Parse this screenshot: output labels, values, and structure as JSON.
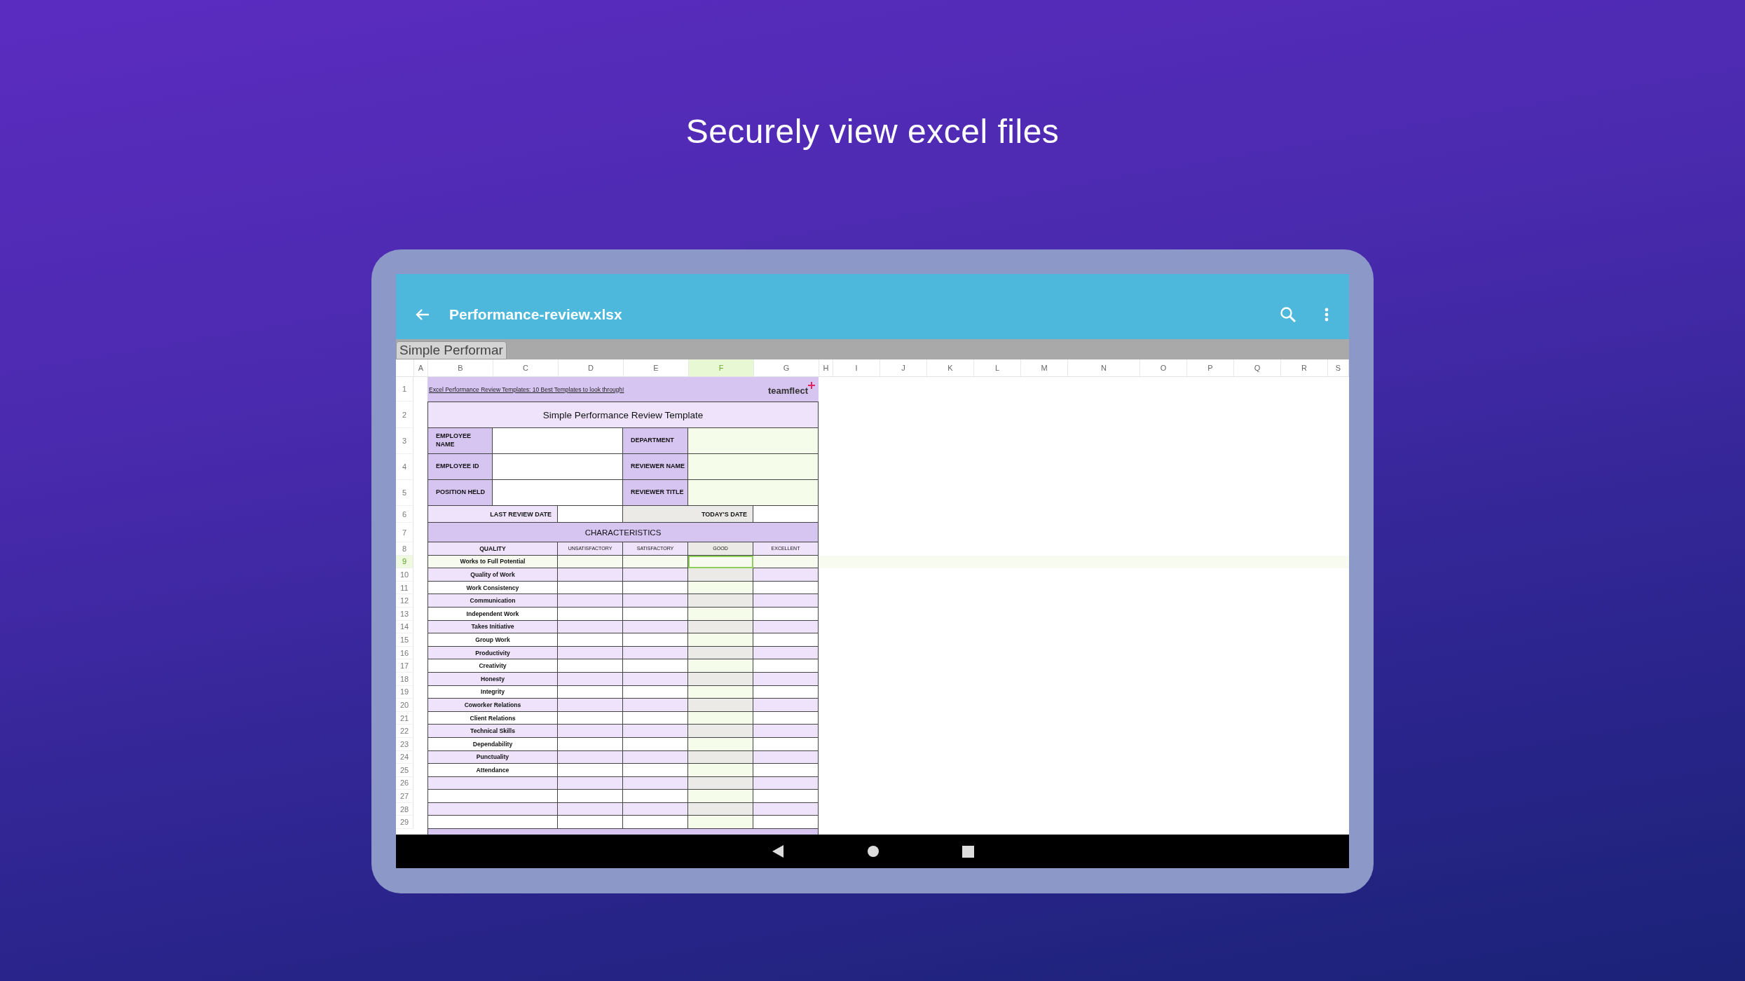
{
  "heading": "Securely view excel files",
  "app_bar": {
    "title": "Performance-review.xlsx"
  },
  "sheet_tabs": [
    {
      "label": "Simple Performar",
      "selected": true
    }
  ],
  "columns": [
    {
      "label": "A",
      "selected": false
    },
    {
      "label": "B",
      "selected": false
    },
    {
      "label": "C",
      "selected": false
    },
    {
      "label": "D",
      "selected": false
    },
    {
      "label": "E",
      "selected": false
    },
    {
      "label": "F",
      "selected": true
    },
    {
      "label": "G",
      "selected": false
    },
    {
      "label": "H",
      "selected": false
    },
    {
      "label": "I",
      "selected": false
    },
    {
      "label": "J",
      "selected": false
    },
    {
      "label": "K",
      "selected": false
    },
    {
      "label": "L",
      "selected": false
    },
    {
      "label": "M",
      "selected": false
    },
    {
      "label": "N",
      "selected": false
    },
    {
      "label": "O",
      "selected": false
    },
    {
      "label": "P",
      "selected": false
    },
    {
      "label": "Q",
      "selected": false
    },
    {
      "label": "R",
      "selected": false
    },
    {
      "label": "S",
      "selected": false
    }
  ],
  "row_numbers": [
    {
      "label": "1",
      "selected": false
    },
    {
      "label": "2",
      "selected": false
    },
    {
      "label": "3",
      "selected": false
    },
    {
      "label": "4",
      "selected": false
    },
    {
      "label": "5",
      "selected": false
    },
    {
      "label": "6",
      "selected": false
    },
    {
      "label": "7",
      "selected": false
    },
    {
      "label": "8",
      "selected": false
    },
    {
      "label": "9",
      "selected": true
    },
    {
      "label": "10",
      "selected": false
    },
    {
      "label": "11",
      "selected": false
    },
    {
      "label": "12",
      "selected": false
    },
    {
      "label": "13",
      "selected": false
    },
    {
      "label": "14",
      "selected": false
    },
    {
      "label": "15",
      "selected": false
    },
    {
      "label": "16",
      "selected": false
    },
    {
      "label": "17",
      "selected": false
    },
    {
      "label": "18",
      "selected": false
    },
    {
      "label": "19",
      "selected": false
    },
    {
      "label": "20",
      "selected": false
    },
    {
      "label": "21",
      "selected": false
    },
    {
      "label": "22",
      "selected": false
    },
    {
      "label": "23",
      "selected": false
    },
    {
      "label": "24",
      "selected": false
    },
    {
      "label": "25",
      "selected": false
    },
    {
      "label": "26",
      "selected": false
    },
    {
      "label": "27",
      "selected": false
    },
    {
      "label": "28",
      "selected": false
    },
    {
      "label": "29",
      "selected": false
    }
  ],
  "sheet": {
    "link": "Excel Performance Review Templates: 10 Best Templates to look through!",
    "logo": "teamflect",
    "title": "Simple Performance Review Template",
    "fields": [
      {
        "left": "EMPLOYEE NAME",
        "right": "DEPARTMENT"
      },
      {
        "left": "EMPLOYEE ID",
        "right": "REVIEWER NAME"
      },
      {
        "left": "POSITION HELD",
        "right": "REVIEWER TITLE"
      }
    ],
    "dates": [
      "LAST REVIEW DATE",
      "TODAY'S DATE"
    ],
    "section": "CHARACTERISTICS",
    "quality_header": "QUALITY",
    "ratings": [
      "UNSATISFACTORY",
      "SATISFACTORY",
      "GOOD",
      "EXCELLENT"
    ],
    "qualities": [
      "Works to Full Potential",
      "Quality of Work",
      "Work Consistency",
      "Communication",
      "Independent Work",
      "Takes Initiative",
      "Group Work",
      "Productivity",
      "Creativity",
      "Honesty",
      "Integrity",
      "Coworker Relations",
      "Client Relations",
      "Technical Skills",
      "Dependability",
      "Punctuality",
      "Attendance"
    ]
  }
}
